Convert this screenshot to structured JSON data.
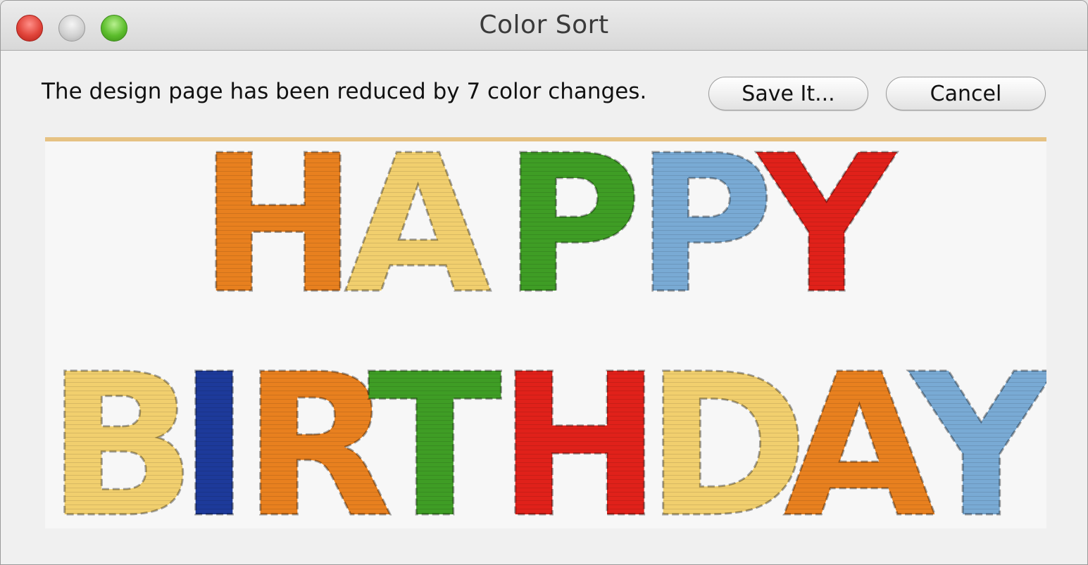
{
  "window": {
    "title": "Color Sort"
  },
  "dialog": {
    "message": "The design page has been reduced by 7 color changes.",
    "save_label": "Save It...",
    "cancel_label": "Cancel"
  },
  "preview": {
    "lines": [
      {
        "text": "HAPPY",
        "letters": [
          {
            "char": "H",
            "color": "#e8801f"
          },
          {
            "char": "A",
            "color": "#f1cf6e"
          },
          {
            "char": "P",
            "color": "#3f9d25"
          },
          {
            "char": "P",
            "color": "#79aad4"
          },
          {
            "char": "Y",
            "color": "#e0211a"
          }
        ]
      },
      {
        "text": "BIRTHDAY",
        "letters": [
          {
            "char": "B",
            "color": "#f1cf6e"
          },
          {
            "char": "I",
            "color": "#1d3a9a"
          },
          {
            "char": "R",
            "color": "#e8801f"
          },
          {
            "char": "T",
            "color": "#3f9d25"
          },
          {
            "char": "H",
            "color": "#e0211a"
          },
          {
            "char": "D",
            "color": "#f1cf6e"
          },
          {
            "char": "A",
            "color": "#e8801f"
          },
          {
            "char": "Y",
            "color": "#79aad4"
          }
        ]
      }
    ]
  }
}
